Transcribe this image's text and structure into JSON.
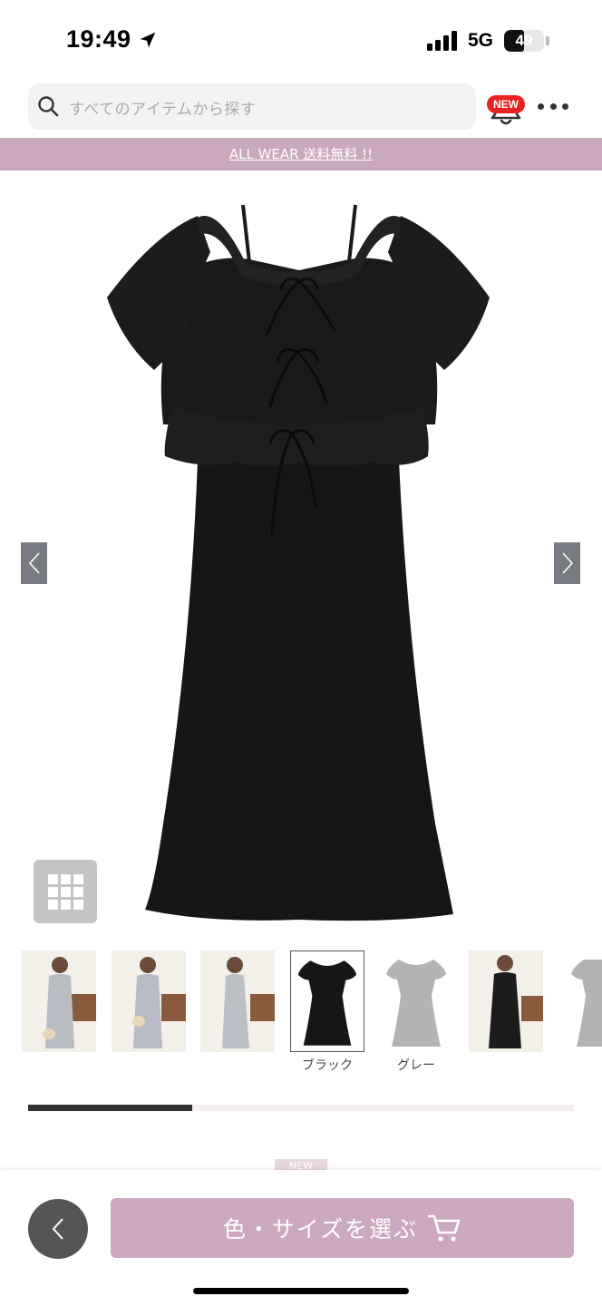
{
  "status_bar": {
    "time": "19:49",
    "network": "5G",
    "battery": "49",
    "battery_level": 0.49,
    "icons": [
      "location-arrow-icon",
      "signal-bars-icon",
      "battery-icon"
    ]
  },
  "header": {
    "search_placeholder": "すべてのアイテムから探す",
    "notification_badge": "NEW",
    "icons": [
      "search-icon",
      "bell-icon",
      "more-dots-icon"
    ]
  },
  "promo": {
    "text": "ALL WEAR 送料無料 !!"
  },
  "gallery": {
    "icons": [
      "chevron-left-icon",
      "chevron-right-icon",
      "grid-icon"
    ],
    "colors": {
      "dress": "#161616",
      "arrow_bg": "#777a80"
    }
  },
  "thumbnails": [
    {
      "kind": "model-photo",
      "color": "gray",
      "label": ""
    },
    {
      "kind": "model-photo",
      "color": "gray",
      "label": ""
    },
    {
      "kind": "model-photo",
      "color": "gray",
      "label": ""
    },
    {
      "kind": "product",
      "color": "black",
      "label": "ブラック",
      "selected": true
    },
    {
      "kind": "product",
      "color": "gray",
      "label": "グレー"
    },
    {
      "kind": "model-photo",
      "color": "black",
      "label": ""
    },
    {
      "kind": "product",
      "color": "gray",
      "label": ""
    }
  ],
  "carousel_progress": 0.3,
  "new_tag": "NEW",
  "bottom_bar": {
    "cta_label": "色・サイズを選ぶ",
    "icons": [
      "back-chevron-icon",
      "cart-icon"
    ],
    "colors": {
      "cta": "#cba8bf",
      "back": "#555557"
    }
  }
}
